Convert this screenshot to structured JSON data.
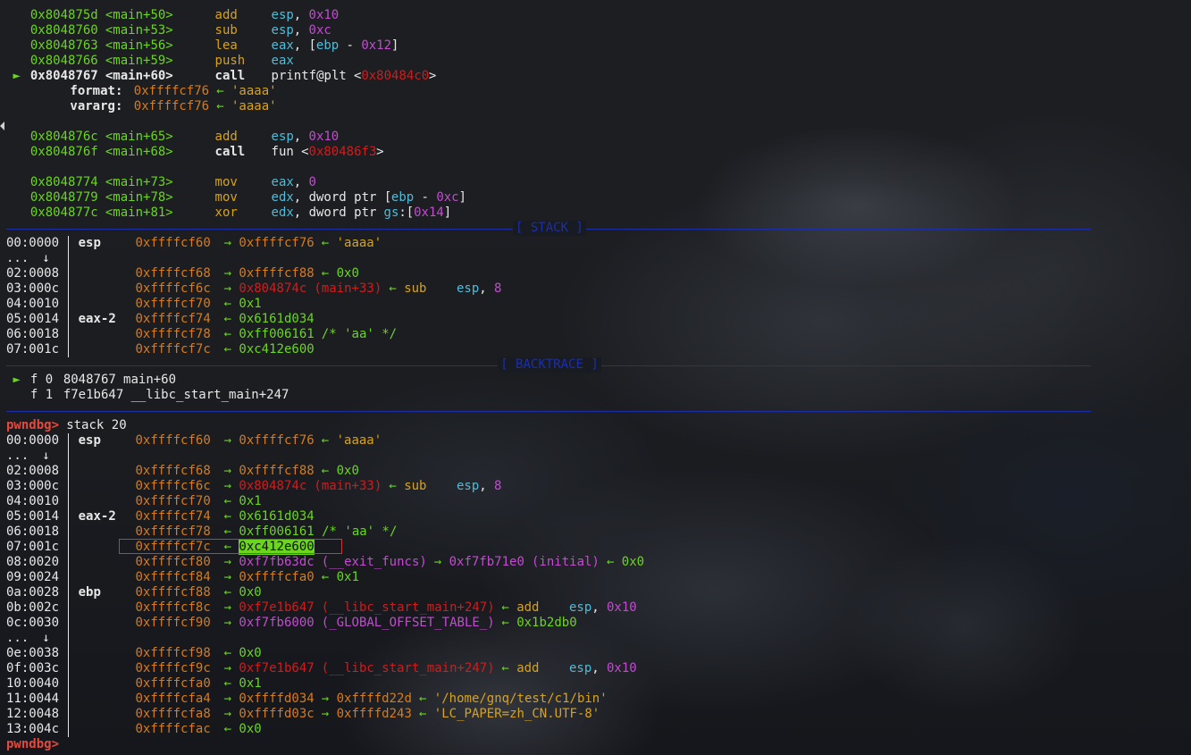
{
  "terminal": {
    "prompt": "pwndbg>",
    "command": "stack 20",
    "disasm": [
      {
        "addr": "0x804875d",
        "sym": "<main+50>",
        "mn": "add",
        "ops": [
          "esp",
          ", ",
          "0x10"
        ]
      },
      {
        "addr": "0x8048760",
        "sym": "<main+53>",
        "mn": "sub",
        "ops": [
          "esp",
          ", ",
          "0xc"
        ]
      },
      {
        "addr": "0x8048763",
        "sym": "<main+56>",
        "mn": "lea",
        "ops": [
          "eax",
          ", [",
          "ebp",
          " - ",
          "0x12",
          "]"
        ]
      },
      {
        "addr": "0x8048766",
        "sym": "<main+59>",
        "mn": "push",
        "ops": [
          "eax"
        ]
      },
      {
        "addr": "0x8048767",
        "sym": "<main+60>",
        "mn": "call",
        "ops": [
          "printf@plt",
          " <",
          "0x80484c0",
          ">"
        ],
        "current": true
      },
      {
        "label": "format:",
        "val": "0xffffcf76",
        "arrow": "←",
        "str": "'aaaa'"
      },
      {
        "label": "vararg:",
        "val": "0xffffcf76",
        "arrow": "←",
        "str": "'aaaa'"
      },
      {
        "addr": "0x804876c",
        "sym": "<main+65>",
        "mn": "add",
        "ops": [
          "esp",
          ", ",
          "0x10"
        ]
      },
      {
        "addr": "0x804876f",
        "sym": "<main+68>",
        "mn": "call",
        "ops": [
          "fun",
          " <",
          "0x80486f3",
          ">"
        ]
      },
      {
        "addr": "0x8048774",
        "sym": "<main+73>",
        "mn": "mov",
        "ops": [
          "eax",
          ", ",
          "0"
        ]
      },
      {
        "addr": "0x8048779",
        "sym": "<main+78>",
        "mn": "mov",
        "ops": [
          "edx",
          ", dword ptr [",
          "ebp",
          " - ",
          "0xc",
          "]"
        ]
      },
      {
        "addr": "0x804877c",
        "sym": "<main+81>",
        "mn": "xor",
        "ops": [
          "edx",
          ", dword ptr ",
          "gs",
          ":[",
          "0x14",
          "]"
        ]
      }
    ],
    "section_stack": "[ STACK ]",
    "section_backtrace": "[ BACKTRACE ]",
    "stack": [
      [
        "00:0000",
        "esp",
        "0xffffcf60",
        "→",
        "0xffffcf76",
        "←",
        "'aaaa'"
      ],
      [
        "...",
        "↓"
      ],
      [
        "02:0008",
        "",
        "0xffffcf68",
        "→",
        "0xffffcf88",
        "←",
        "0x0"
      ],
      [
        "03:000c",
        "",
        "0xffffcf6c",
        "→",
        "0x804874c",
        "(main+33)",
        "←",
        "sub",
        "esp",
        ", ",
        "8"
      ],
      [
        "04:0010",
        "",
        "0xffffcf70",
        "←",
        "0x1"
      ],
      [
        "05:0014",
        "eax-2",
        "0xffffcf74",
        "←",
        "0x6161d034"
      ],
      [
        "06:0018",
        "",
        "0xffffcf78",
        "←",
        "0xff006161",
        "/* 'aa' */"
      ],
      [
        "07:001c",
        "",
        "0xffffcf7c",
        "←",
        "0xc412e600"
      ]
    ],
    "backtrace": [
      {
        "marker": "►",
        "frame": "f 0",
        "addr": "8048767",
        "sym": "main+60"
      },
      {
        "marker": "",
        "frame": "f 1",
        "addr": "f7e1b647",
        "sym": "__libc_start_main+247"
      }
    ],
    "stack20": [
      {
        "off": "00:0000",
        "reg": "esp",
        "a": "0xffffcf60",
        "rest": [
          [
            "→",
            "g"
          ],
          [
            "0xffffcf76",
            "o"
          ],
          [
            "←",
            "g"
          ],
          [
            "'aaaa'",
            "y"
          ]
        ]
      },
      {
        "off": "...",
        "dots": "↓"
      },
      {
        "off": "02:0008",
        "reg": "",
        "a": "0xffffcf68",
        "rest": [
          [
            "→",
            "g"
          ],
          [
            "0xffffcf88",
            "o"
          ],
          [
            "←",
            "g"
          ],
          [
            "0x0",
            "g"
          ]
        ]
      },
      {
        "off": "03:000c",
        "reg": "",
        "a": "0xffffcf6c",
        "rest": [
          [
            "→",
            "g"
          ],
          [
            "0x804874c",
            "r"
          ],
          [
            "(main+33)",
            "r"
          ],
          [
            "←",
            "g"
          ],
          [
            "sub",
            "y"
          ],
          [
            "esp",
            "c"
          ],
          [
            ", ",
            "w"
          ],
          [
            "8",
            "m"
          ]
        ]
      },
      {
        "off": "04:0010",
        "reg": "",
        "a": "0xffffcf70",
        "rest": [
          [
            "←",
            "g"
          ],
          [
            "0x1",
            "g"
          ]
        ]
      },
      {
        "off": "05:0014",
        "reg": "eax-2",
        "a": "0xffffcf74",
        "rest": [
          [
            "←",
            "g"
          ],
          [
            "0x6161d034",
            "g"
          ]
        ]
      },
      {
        "off": "06:0018",
        "reg": "",
        "a": "0xffffcf78",
        "rest": [
          [
            "←",
            "g"
          ],
          [
            "0xff006161 /* 'aa' */",
            "g"
          ]
        ]
      },
      {
        "off": "07:001c",
        "reg": "",
        "a": "0xffffcf7c",
        "rest": [
          [
            "←",
            "g"
          ],
          [
            "0xc412e600",
            "sel"
          ]
        ],
        "highlight": true
      },
      {
        "off": "08:0020",
        "reg": "",
        "a": "0xffffcf80",
        "rest": [
          [
            "→",
            "g"
          ],
          [
            "0xf7fb63dc",
            "m"
          ],
          [
            "(__exit_funcs)",
            "m"
          ],
          [
            "→",
            "g"
          ],
          [
            "0xf7fb71e0",
            "m"
          ],
          [
            "(initial)",
            "m"
          ],
          [
            "←",
            "g"
          ],
          [
            "0x0",
            "g"
          ]
        ]
      },
      {
        "off": "09:0024",
        "reg": "",
        "a": "0xffffcf84",
        "rest": [
          [
            "→",
            "g"
          ],
          [
            "0xffffcfa0",
            "o"
          ],
          [
            "←",
            "g"
          ],
          [
            "0x1",
            "g"
          ]
        ]
      },
      {
        "off": "0a:0028",
        "reg": "ebp",
        "a": "0xffffcf88",
        "rest": [
          [
            "←",
            "g"
          ],
          [
            "0x0",
            "g"
          ]
        ]
      },
      {
        "off": "0b:002c",
        "reg": "",
        "a": "0xffffcf8c",
        "rest": [
          [
            "→",
            "g"
          ],
          [
            "0xf7e1b647",
            "r"
          ],
          [
            "(__libc_start_main+247)",
            "r"
          ],
          [
            "←",
            "g"
          ],
          [
            "add",
            "y"
          ],
          [
            "esp",
            "c"
          ],
          [
            ", ",
            "w"
          ],
          [
            "0x10",
            "m"
          ]
        ]
      },
      {
        "off": "0c:0030",
        "reg": "",
        "a": "0xffffcf90",
        "rest": [
          [
            "→",
            "g"
          ],
          [
            "0xf7fb6000",
            "m"
          ],
          [
            "(_GLOBAL_OFFSET_TABLE_)",
            "m"
          ],
          [
            "←",
            "g"
          ],
          [
            "0x1b2db0",
            "g"
          ]
        ]
      },
      {
        "off": "...",
        "dots": "↓"
      },
      {
        "off": "0e:0038",
        "reg": "",
        "a": "0xffffcf98",
        "rest": [
          [
            "←",
            "g"
          ],
          [
            "0x0",
            "g"
          ]
        ]
      },
      {
        "off": "0f:003c",
        "reg": "",
        "a": "0xffffcf9c",
        "rest": [
          [
            "→",
            "g"
          ],
          [
            "0xf7e1b647",
            "r"
          ],
          [
            "(__libc_start_main+247)",
            "r"
          ],
          [
            "←",
            "g"
          ],
          [
            "add",
            "y"
          ],
          [
            "esp",
            "c"
          ],
          [
            ", ",
            "w"
          ],
          [
            "0x10",
            "m"
          ]
        ]
      },
      {
        "off": "10:0040",
        "reg": "",
        "a": "0xffffcfa0",
        "rest": [
          [
            "←",
            "g"
          ],
          [
            "0x1",
            "g"
          ]
        ]
      },
      {
        "off": "11:0044",
        "reg": "",
        "a": "0xffffcfa4",
        "rest": [
          [
            "→",
            "g"
          ],
          [
            "0xffffd034",
            "o"
          ],
          [
            "→",
            "g"
          ],
          [
            "0xffffd22d",
            "o"
          ],
          [
            "←",
            "g"
          ],
          [
            "'/home/gnq/test/c1/bin'",
            "y"
          ]
        ]
      },
      {
        "off": "12:0048",
        "reg": "",
        "a": "0xffffcfa8",
        "rest": [
          [
            "→",
            "g"
          ],
          [
            "0xffffd03c",
            "o"
          ],
          [
            "→",
            "g"
          ],
          [
            "0xffffd243",
            "o"
          ],
          [
            "←",
            "g"
          ],
          [
            "'LC_PAPER=zh_CN.UTF-8'",
            "y"
          ]
        ]
      },
      {
        "off": "13:004c",
        "reg": "",
        "a": "0xffffcfac",
        "rest": [
          [
            "←",
            "g"
          ],
          [
            "0x0",
            "g"
          ]
        ]
      }
    ]
  }
}
